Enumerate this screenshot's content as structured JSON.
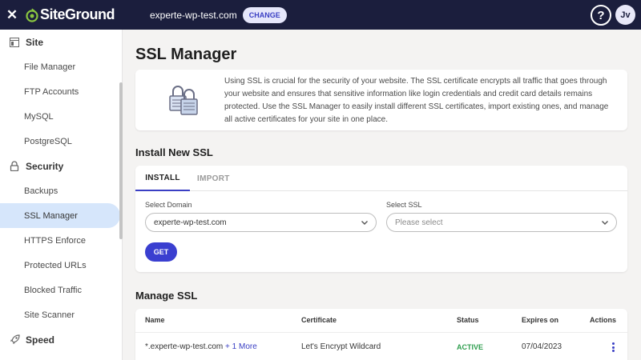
{
  "topbar": {
    "logo_text": "SiteGround",
    "domain": "experte-wp-test.com",
    "change_label": "CHANGE",
    "help_label": "?",
    "avatar_initials": "Jv"
  },
  "sidebar": {
    "sections": [
      {
        "label": "Site",
        "icon": "site-icon"
      },
      {
        "label": "Security",
        "icon": "lock-icon"
      },
      {
        "label": "Speed",
        "icon": "rocket-icon"
      }
    ],
    "site_items": [
      "File Manager",
      "FTP Accounts",
      "MySQL",
      "PostgreSQL"
    ],
    "security_items": [
      "Backups",
      "SSL Manager",
      "HTTPS Enforce",
      "Protected URLs",
      "Blocked Traffic",
      "Site Scanner"
    ],
    "active_item": "SSL Manager"
  },
  "main": {
    "title": "SSL Manager",
    "info_text": "Using SSL is crucial for the security of your website. The SSL certificate encrypts all traffic that goes through your website and ensures that sensitive information like login credentials and credit card details remains protected. Use the SSL Manager to easily install different SSL certificates, import existing ones, and manage all active certificates for your site in one place.",
    "install_title": "Install New SSL",
    "tabs": [
      "INSTALL",
      "IMPORT"
    ],
    "domain_label": "Select Domain",
    "domain_value": "experte-wp-test.com",
    "ssl_label": "Select SSL",
    "ssl_placeholder": "Please select",
    "get_label": "GET",
    "manage_title": "Manage SSL",
    "table": {
      "headers": [
        "Name",
        "Certificate",
        "Status",
        "Expires on",
        "Actions"
      ],
      "rows": [
        {
          "name": "*.experte-wp-test.com",
          "more": "+ 1 More",
          "certificate": "Let's Encrypt Wildcard",
          "status": "ACTIVE",
          "expires": "07/04/2023"
        }
      ]
    }
  },
  "colors": {
    "topbar": "#1b1e3d",
    "accent": "#3a3fc4",
    "logo_green": "#8ac640",
    "active_item": "#d6e6fb",
    "status_active": "#2e9e4e"
  }
}
